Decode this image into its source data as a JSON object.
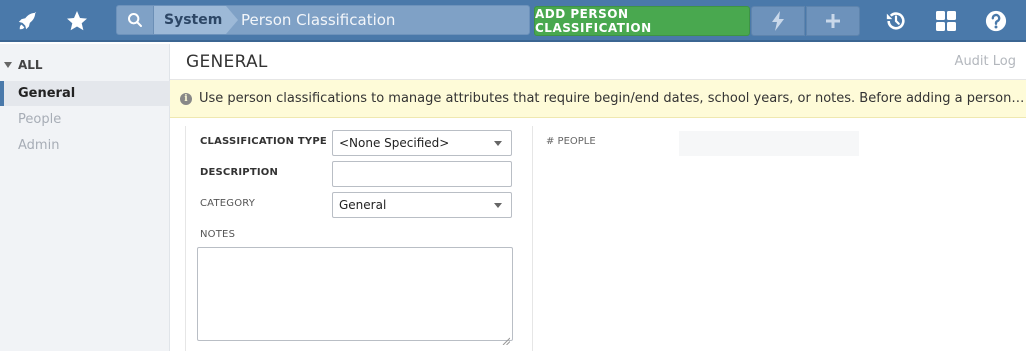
{
  "topbar": {
    "icons": [
      "rocket-icon",
      "star-icon",
      "search-icon",
      "lightning-icon",
      "plus-icon",
      "history-icon",
      "grid-icon",
      "help-icon"
    ],
    "breadcrumb": {
      "section": "System",
      "page": "Person Classification"
    },
    "add_button_label": "ADD PERSON CLASSIFICATION"
  },
  "sidebar": {
    "group_label": "ALL",
    "items": [
      {
        "label": "General",
        "active": true
      },
      {
        "label": "People",
        "active": false
      },
      {
        "label": "Admin",
        "active": false
      }
    ]
  },
  "main": {
    "title": "GENERAL",
    "audit_link": "Audit Log",
    "notice": "Use person classifications to manage attributes that require begin/end dates, school years, or notes.  Before adding a person classification…",
    "form": {
      "classification_type_label": "CLASSIFICATION TYPE",
      "classification_type_value": "<None Specified>",
      "description_label": "DESCRIPTION",
      "description_value": "",
      "category_label": "CATEGORY",
      "category_value": "General",
      "notes_label": "NOTES",
      "notes_value": ""
    },
    "people_label": "# PEOPLE",
    "people_value": ""
  },
  "colors": {
    "topbar": "#4a79aa",
    "add_button": "#49a84f",
    "notice_bg": "#fefbd8"
  }
}
